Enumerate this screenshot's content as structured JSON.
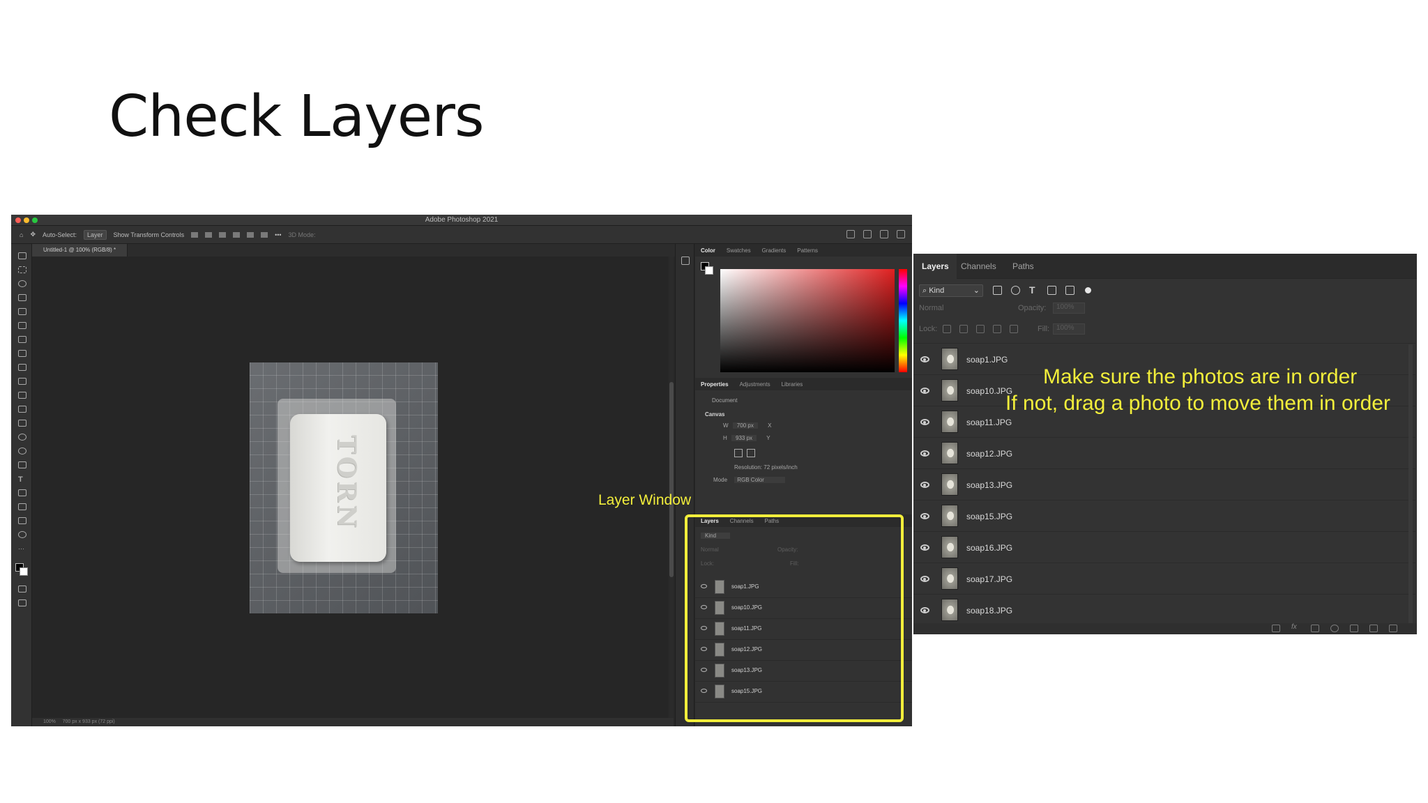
{
  "slide": {
    "title": "Check Layers"
  },
  "photoshop": {
    "window_title": "Adobe Photoshop 2021",
    "options_bar": {
      "auto_select_label": "Auto-Select:",
      "auto_select_value": "Layer",
      "show_transform_label": "Show Transform Controls",
      "mode_3d_label": "3D Mode:"
    },
    "doc_tab": "Untitled-1 @ 100% (RGB/8) *",
    "status": {
      "zoom": "100%",
      "size": "700 px x 933 px (72 ppi)"
    },
    "photo_engraving": "TORN",
    "panels": {
      "color_tabs": [
        "Color",
        "Swatches",
        "Gradients",
        "Patterns"
      ],
      "properties_tabs": [
        "Properties",
        "Adjustments",
        "Libraries"
      ],
      "properties": {
        "doc_label": "Document",
        "canvas_label": "Canvas",
        "w_label": "W",
        "w_value": "700 px",
        "h_label": "H",
        "h_value": "933 px",
        "x_label": "X",
        "y_label": "Y",
        "resolution": "Resolution: 72 pixels/inch",
        "mode_label": "Mode",
        "mode_value": "RGB Color"
      },
      "layers_small": {
        "tabs": [
          "Layers",
          "Channels",
          "Paths"
        ],
        "kind_label": "Kind",
        "blend_label": "Normal",
        "opacity_label": "Opacity:",
        "lock_label": "Lock:",
        "fill_label": "Fill:",
        "rows": [
          "soap1.JPG",
          "soap10.JPG",
          "soap11.JPG",
          "soap12.JPG",
          "soap13.JPG",
          "soap15.JPG"
        ]
      }
    }
  },
  "annotations": {
    "layer_window": "Layer Window",
    "order_line1": "Make sure the photos are in order",
    "order_line2": "If not, drag a photo to move them in order"
  },
  "layers_panel": {
    "tabs": [
      "Layers",
      "Channels",
      "Paths"
    ],
    "filter_label": "Kind",
    "blend_mode": "Normal",
    "opacity_label": "Opacity:",
    "opacity_value": "100%",
    "lock_label": "Lock:",
    "fill_label": "Fill:",
    "fill_value": "100%",
    "layers": [
      "soap1.JPG",
      "soap10.JPG",
      "soap11.JPG",
      "soap12.JPG",
      "soap13.JPG",
      "soap15.JPG",
      "soap16.JPG",
      "soap17.JPG",
      "soap18.JPG"
    ]
  },
  "colors": {
    "highlight": "#f2ee3b",
    "ps_bg": "#282828",
    "panel_bg": "#333333"
  }
}
